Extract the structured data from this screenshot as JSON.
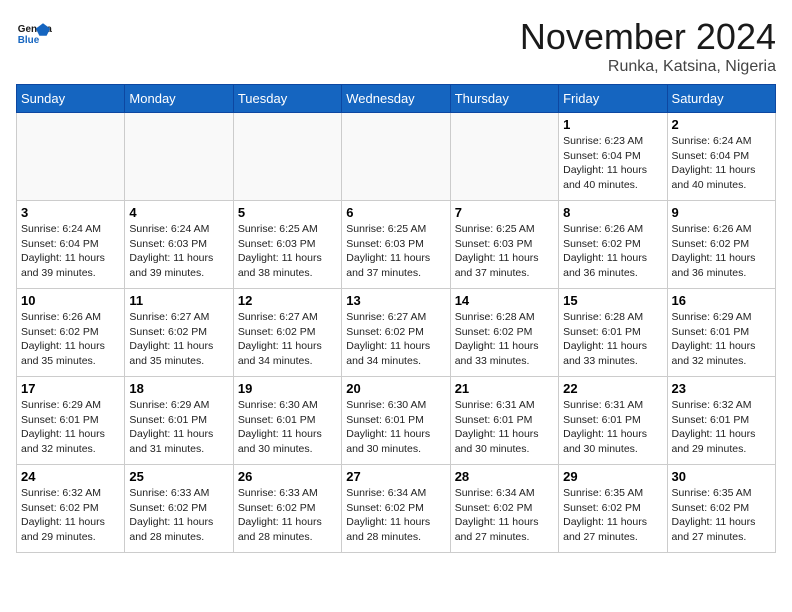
{
  "header": {
    "logo_line1": "General",
    "logo_line2": "Blue",
    "month_title": "November 2024",
    "subtitle": "Runka, Katsina, Nigeria"
  },
  "weekdays": [
    "Sunday",
    "Monday",
    "Tuesday",
    "Wednesday",
    "Thursday",
    "Friday",
    "Saturday"
  ],
  "weeks": [
    [
      {
        "day": "",
        "info": ""
      },
      {
        "day": "",
        "info": ""
      },
      {
        "day": "",
        "info": ""
      },
      {
        "day": "",
        "info": ""
      },
      {
        "day": "",
        "info": ""
      },
      {
        "day": "1",
        "info": "Sunrise: 6:23 AM\nSunset: 6:04 PM\nDaylight: 11 hours\nand 40 minutes."
      },
      {
        "day": "2",
        "info": "Sunrise: 6:24 AM\nSunset: 6:04 PM\nDaylight: 11 hours\nand 40 minutes."
      }
    ],
    [
      {
        "day": "3",
        "info": "Sunrise: 6:24 AM\nSunset: 6:04 PM\nDaylight: 11 hours\nand 39 minutes."
      },
      {
        "day": "4",
        "info": "Sunrise: 6:24 AM\nSunset: 6:03 PM\nDaylight: 11 hours\nand 39 minutes."
      },
      {
        "day": "5",
        "info": "Sunrise: 6:25 AM\nSunset: 6:03 PM\nDaylight: 11 hours\nand 38 minutes."
      },
      {
        "day": "6",
        "info": "Sunrise: 6:25 AM\nSunset: 6:03 PM\nDaylight: 11 hours\nand 37 minutes."
      },
      {
        "day": "7",
        "info": "Sunrise: 6:25 AM\nSunset: 6:03 PM\nDaylight: 11 hours\nand 37 minutes."
      },
      {
        "day": "8",
        "info": "Sunrise: 6:26 AM\nSunset: 6:02 PM\nDaylight: 11 hours\nand 36 minutes."
      },
      {
        "day": "9",
        "info": "Sunrise: 6:26 AM\nSunset: 6:02 PM\nDaylight: 11 hours\nand 36 minutes."
      }
    ],
    [
      {
        "day": "10",
        "info": "Sunrise: 6:26 AM\nSunset: 6:02 PM\nDaylight: 11 hours\nand 35 minutes."
      },
      {
        "day": "11",
        "info": "Sunrise: 6:27 AM\nSunset: 6:02 PM\nDaylight: 11 hours\nand 35 minutes."
      },
      {
        "day": "12",
        "info": "Sunrise: 6:27 AM\nSunset: 6:02 PM\nDaylight: 11 hours\nand 34 minutes."
      },
      {
        "day": "13",
        "info": "Sunrise: 6:27 AM\nSunset: 6:02 PM\nDaylight: 11 hours\nand 34 minutes."
      },
      {
        "day": "14",
        "info": "Sunrise: 6:28 AM\nSunset: 6:02 PM\nDaylight: 11 hours\nand 33 minutes."
      },
      {
        "day": "15",
        "info": "Sunrise: 6:28 AM\nSunset: 6:01 PM\nDaylight: 11 hours\nand 33 minutes."
      },
      {
        "day": "16",
        "info": "Sunrise: 6:29 AM\nSunset: 6:01 PM\nDaylight: 11 hours\nand 32 minutes."
      }
    ],
    [
      {
        "day": "17",
        "info": "Sunrise: 6:29 AM\nSunset: 6:01 PM\nDaylight: 11 hours\nand 32 minutes."
      },
      {
        "day": "18",
        "info": "Sunrise: 6:29 AM\nSunset: 6:01 PM\nDaylight: 11 hours\nand 31 minutes."
      },
      {
        "day": "19",
        "info": "Sunrise: 6:30 AM\nSunset: 6:01 PM\nDaylight: 11 hours\nand 30 minutes."
      },
      {
        "day": "20",
        "info": "Sunrise: 6:30 AM\nSunset: 6:01 PM\nDaylight: 11 hours\nand 30 minutes."
      },
      {
        "day": "21",
        "info": "Sunrise: 6:31 AM\nSunset: 6:01 PM\nDaylight: 11 hours\nand 30 minutes."
      },
      {
        "day": "22",
        "info": "Sunrise: 6:31 AM\nSunset: 6:01 PM\nDaylight: 11 hours\nand 30 minutes."
      },
      {
        "day": "23",
        "info": "Sunrise: 6:32 AM\nSunset: 6:01 PM\nDaylight: 11 hours\nand 29 minutes."
      }
    ],
    [
      {
        "day": "24",
        "info": "Sunrise: 6:32 AM\nSunset: 6:02 PM\nDaylight: 11 hours\nand 29 minutes."
      },
      {
        "day": "25",
        "info": "Sunrise: 6:33 AM\nSunset: 6:02 PM\nDaylight: 11 hours\nand 28 minutes."
      },
      {
        "day": "26",
        "info": "Sunrise: 6:33 AM\nSunset: 6:02 PM\nDaylight: 11 hours\nand 28 minutes."
      },
      {
        "day": "27",
        "info": "Sunrise: 6:34 AM\nSunset: 6:02 PM\nDaylight: 11 hours\nand 28 minutes."
      },
      {
        "day": "28",
        "info": "Sunrise: 6:34 AM\nSunset: 6:02 PM\nDaylight: 11 hours\nand 27 minutes."
      },
      {
        "day": "29",
        "info": "Sunrise: 6:35 AM\nSunset: 6:02 PM\nDaylight: 11 hours\nand 27 minutes."
      },
      {
        "day": "30",
        "info": "Sunrise: 6:35 AM\nSunset: 6:02 PM\nDaylight: 11 hours\nand 27 minutes."
      }
    ]
  ]
}
